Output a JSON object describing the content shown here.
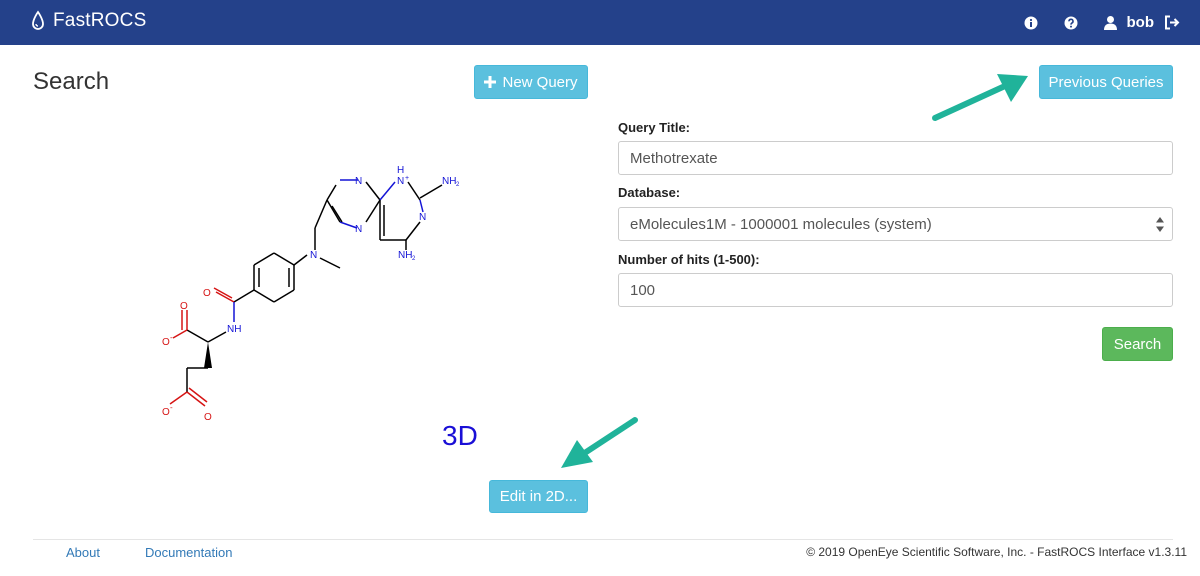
{
  "navbar": {
    "brand": "FastROCS",
    "icons": [
      "info-icon",
      "help-icon",
      "user-icon",
      "logout-icon"
    ],
    "user": "bob",
    "color": "#24418a"
  },
  "page": {
    "title": "Search",
    "new_query_label": "New Query",
    "previous_queries_label": "Previous Queries"
  },
  "form": {
    "query_title_label": "Query Title:",
    "query_title_value": "Methotrexate",
    "database_label": "Database:",
    "database_value": "eMolecules1M - 1000001 molecules (system)",
    "hits_label": "Number of hits (1-500):",
    "hits_value": "100",
    "search_label": "Search"
  },
  "molecule": {
    "atoms": {
      "n": "N",
      "nh": "H",
      "nplus": "N",
      "nplus_charge": "+",
      "nh2": "NH",
      "nh2_sub": "2",
      "o": "O",
      "o_minus": "-"
    }
  },
  "viewer": {
    "label_3d": "3D",
    "edit_2d_label": "Edit in 2D..."
  },
  "footer": {
    "about": "About",
    "documentation": "Documentation",
    "copyright": "© 2019 OpenEye Scientific Software, Inc. - FastROCS Interface v1.3.11"
  },
  "colors": {
    "info": "#5bc0de",
    "success": "#5cb85c",
    "arrow": "#20b39a",
    "nitrogen": "#1414d6",
    "oxygen": "#d61414"
  }
}
